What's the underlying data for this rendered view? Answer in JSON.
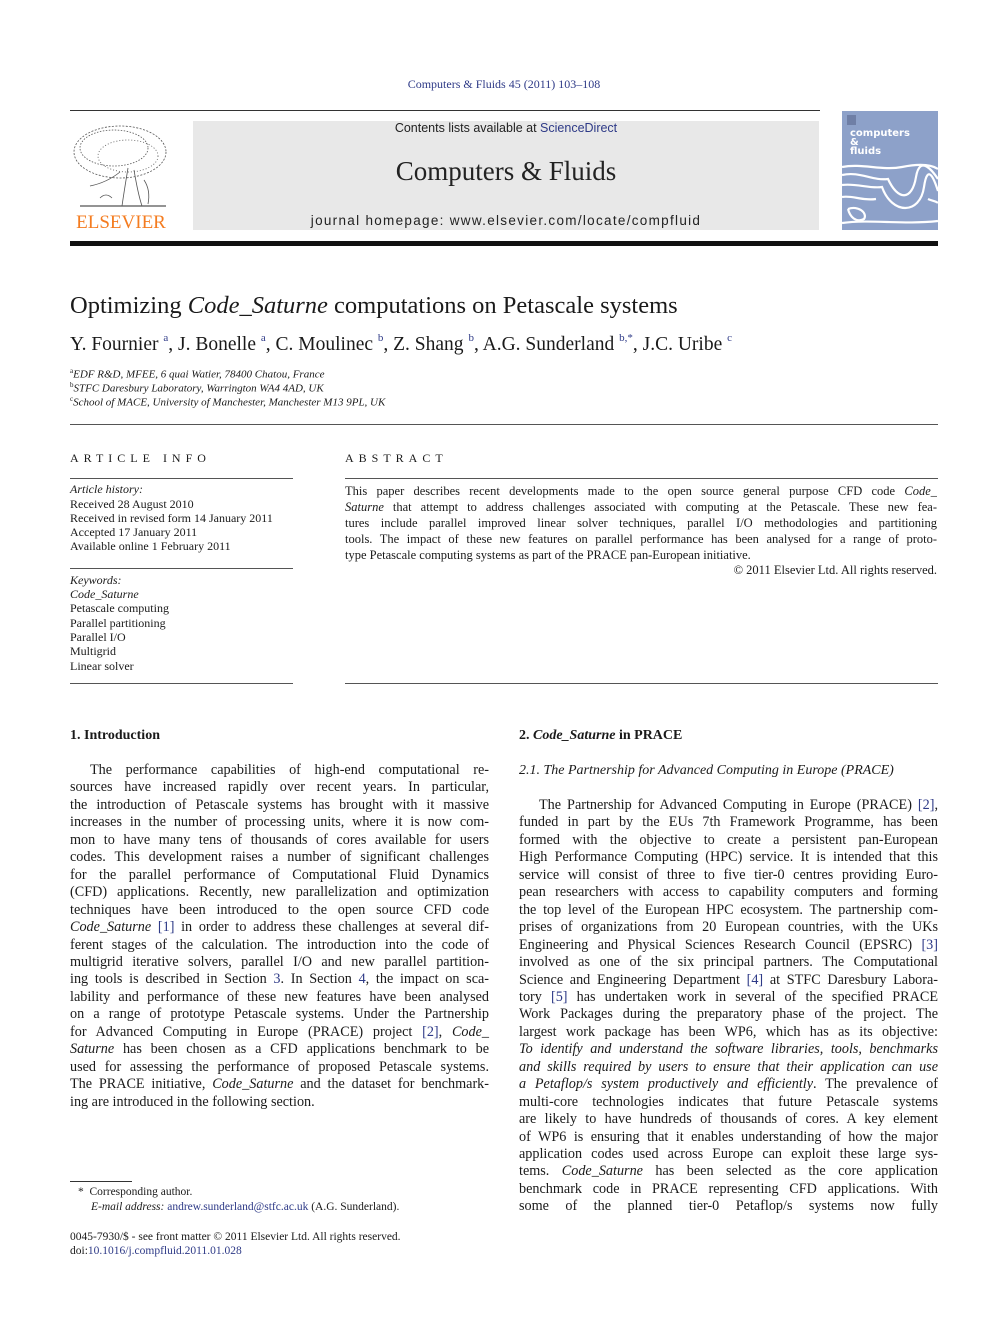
{
  "header": {
    "running_head": "Computers & Fluids 45 (2011) 103–108",
    "publisher_logo_text": "ELSEVIER",
    "contents_prefix": "Contents lists available at ",
    "contents_link": "ScienceDirect",
    "journal_title": "Computers & Fluids",
    "homepage_prefix": "journal homepage: ",
    "homepage_url": "www.elsevier.com/locate/compfluid",
    "cover_lines": [
      "computers",
      "&",
      "fluids"
    ],
    "colors": {
      "link": "#2e3a87",
      "elsevier_orange": "#f47c20",
      "banner_gray": "#e8e8e8",
      "cover_blue": "#8da1c9"
    }
  },
  "article": {
    "title_pre": "Optimizing ",
    "title_italic": "Code_Saturne",
    "title_post": " computations on Petascale systems",
    "authors": [
      {
        "name": "Y. Fournier",
        "sup": "a",
        "sep": ", "
      },
      {
        "name": "J. Bonelle",
        "sup": "a",
        "sep": ", "
      },
      {
        "name": "C. Moulinec",
        "sup": "b",
        "sep": ", "
      },
      {
        "name": "Z. Shang",
        "sup": "b",
        "sep": ", "
      },
      {
        "name": "A.G. Sunderland",
        "sup": "b,*",
        "sep": ", "
      },
      {
        "name": "J.C. Uribe",
        "sup": "c",
        "sep": ""
      }
    ],
    "affiliations": [
      {
        "sup": "a",
        "text": "EDF R&D, MFEE, 6 quai Watier, 78400 Chatou, France"
      },
      {
        "sup": "b",
        "text": "STFC Daresbury Laboratory, Warrington WA4 4AD, UK"
      },
      {
        "sup": "c",
        "text": "School of MACE, University of Manchester, Manchester M13 9PL, UK"
      }
    ]
  },
  "article_info": {
    "heading": "ARTICLE INFO",
    "history_label": "Article history:",
    "history": [
      "Received 28 August 2010",
      "Received in revised form 14 January 2011",
      "Accepted 17 January 2011",
      "Available online 1 February 2011"
    ],
    "keywords_label": "Keywords:",
    "keywords": [
      "Code_Saturne",
      "Petascale computing",
      "Parallel partitioning",
      "Parallel I/O",
      "Multigrid",
      "Linear solver"
    ]
  },
  "abstract": {
    "heading": "ABSTRACT",
    "lines": [
      {
        "pre": "This paper describes recent developments made to the open source general purpose CFD code ",
        "it": "Code_",
        "post": ""
      },
      {
        "pre": "",
        "it": "Saturne",
        "post": " that attempt to address challenges associated with computing at the Petascale. These new fea-"
      },
      {
        "pre": "tures include parallel improved linear solver techniques, parallel I/O methodologies and partitioning",
        "it": "",
        "post": ""
      },
      {
        "pre": "tools. The impact of these new features on parallel performance has been analysed for a range of proto-",
        "it": "",
        "post": ""
      },
      {
        "pre": "type Petascale computing systems as part of the PRACE pan-European initiative.",
        "it": "",
        "post": ""
      }
    ],
    "copyright": "© 2011 Elsevier Ltd. All rights reserved."
  },
  "section1": {
    "heading": "1. Introduction",
    "lines": [
      [
        {
          "t": "The performance capabilities of high-end computational re-"
        }
      ],
      [
        {
          "t": "sources have increased rapidly over recent years. In particular,"
        }
      ],
      [
        {
          "t": "the introduction of Petascale systems has brought with it massive"
        }
      ],
      [
        {
          "t": "increases in the number of processing units, where it is now com-"
        }
      ],
      [
        {
          "t": "mon to have many tens of thousands of cores available for users"
        }
      ],
      [
        {
          "t": "codes. This development raises a number of significant challenges"
        }
      ],
      [
        {
          "t": "for the parallel performance of Computational Fluid Dynamics"
        }
      ],
      [
        {
          "t": "(CFD) applications. Recently, new parallelization and optimization"
        }
      ],
      [
        {
          "t": "techniques have been introduced to the open source CFD code"
        }
      ],
      [
        {
          "t": "Code_Saturne",
          "s": "it"
        },
        {
          "t": " "
        },
        {
          "t": "[1]",
          "s": "link"
        },
        {
          "t": " in order to address these challenges at several dif-"
        }
      ],
      [
        {
          "t": "ferent stages of the calculation. The introduction into the code of"
        }
      ],
      [
        {
          "t": "multigrid iterative solvers, parallel I/O and new parallel partition-"
        }
      ],
      [
        {
          "t": "ing tools is described in Section "
        },
        {
          "t": "3",
          "s": "link"
        },
        {
          "t": ". In Section "
        },
        {
          "t": "4",
          "s": "link"
        },
        {
          "t": ", the impact on sca-"
        }
      ],
      [
        {
          "t": "lability and performance of these new features have been analysed"
        }
      ],
      [
        {
          "t": "on a range of prototype Petascale systems. Under the Partnership"
        }
      ],
      [
        {
          "t": "for Advanced Computing in Europe (PRACE) project "
        },
        {
          "t": "[2]",
          "s": "link"
        },
        {
          "t": ", "
        },
        {
          "t": "Code_",
          "s": "it"
        }
      ],
      [
        {
          "t": "Saturne",
          "s": "it"
        },
        {
          "t": " has been chosen as a CFD applications benchmark to be"
        }
      ],
      [
        {
          "t": "used for assessing the performance of proposed Petascale systems."
        }
      ],
      [
        {
          "t": "The PRACE initiative, "
        },
        {
          "t": "Code_Saturne",
          "s": "it"
        },
        {
          "t": " and the dataset for benchmark-"
        }
      ],
      [
        {
          "t": "ing are introduced in the following section."
        }
      ]
    ]
  },
  "section2": {
    "heading_num": "2. ",
    "heading_it": "Code_Saturne",
    "heading_post": " in PRACE",
    "subheading": "2.1. The Partnership for Advanced Computing in Europe (PRACE)",
    "lines": [
      [
        {
          "t": "The Partnership for Advanced Computing in Europe (PRACE) "
        },
        {
          "t": "[2]",
          "s": "link"
        },
        {
          "t": ","
        }
      ],
      [
        {
          "t": "funded in part by the EUs 7th Framework Programme, has been"
        }
      ],
      [
        {
          "t": "formed with the objective to create a persistent pan-European"
        }
      ],
      [
        {
          "t": "High Performance Computing (HPC) service. It is intended that this"
        }
      ],
      [
        {
          "t": "service will consist of three to five tier-0 centres providing Euro-"
        }
      ],
      [
        {
          "t": "pean researchers with access to capability computers and forming"
        }
      ],
      [
        {
          "t": "the top level of the European HPC ecosystem. The partnership com-"
        }
      ],
      [
        {
          "t": "prises of organizations from 20 European countries, with the UKs"
        }
      ],
      [
        {
          "t": "Engineering and Physical Sciences Research Council (EPSRC) "
        },
        {
          "t": "[3]",
          "s": "link"
        }
      ],
      [
        {
          "t": "involved as one of the six principal partners. The Computational"
        }
      ],
      [
        {
          "t": "Science and Engineering Department "
        },
        {
          "t": "[4]",
          "s": "link"
        },
        {
          "t": " at STFC Daresbury Labora-"
        }
      ],
      [
        {
          "t": "tory "
        },
        {
          "t": "[5]",
          "s": "link"
        },
        {
          "t": " has undertaken work in several of the specified PRACE"
        }
      ],
      [
        {
          "t": "Work Packages during the preparatory phase of the project. The"
        }
      ],
      [
        {
          "t": "largest work package has been WP6, which has as its objective:"
        }
      ],
      [
        {
          "t": "To identify and understand the software libraries, tools, benchmarks",
          "s": "it"
        }
      ],
      [
        {
          "t": "and skills required by users to ensure that their application can use",
          "s": "it"
        }
      ],
      [
        {
          "t": "a Petaflop/s system productively and efficiently",
          "s": "it"
        },
        {
          "t": ". The prevalence of"
        }
      ],
      [
        {
          "t": "multi-core technologies indicates that future Petascale systems"
        }
      ],
      [
        {
          "t": "are likely to have hundreds of thousands of cores. A key element"
        }
      ],
      [
        {
          "t": "of WP6 is ensuring that it enables understanding of how the major"
        }
      ],
      [
        {
          "t": "application codes used across Europe can exploit these large sys-"
        }
      ],
      [
        {
          "t": "tems. "
        },
        {
          "t": "Code_Saturne",
          "s": "it"
        },
        {
          "t": " has been selected as the core application"
        }
      ],
      [
        {
          "t": "benchmark code in PRACE representing CFD applications. With"
        }
      ],
      [
        {
          "t": "some of the planned tier-0 Petaflop/s systems now fully"
        }
      ]
    ]
  },
  "footnotes": {
    "star": "*",
    "corresponding": "Corresponding author.",
    "email_label": "E-mail address: ",
    "email": "andrew.sunderland@stfc.ac.uk",
    "email_suffix": " (A.G. Sunderland).",
    "issn_line": "0045-7930/$ - see front matter © 2011 Elsevier Ltd. All rights reserved.",
    "doi_label": "doi:",
    "doi": "10.1016/j.compfluid.2011.01.028"
  }
}
